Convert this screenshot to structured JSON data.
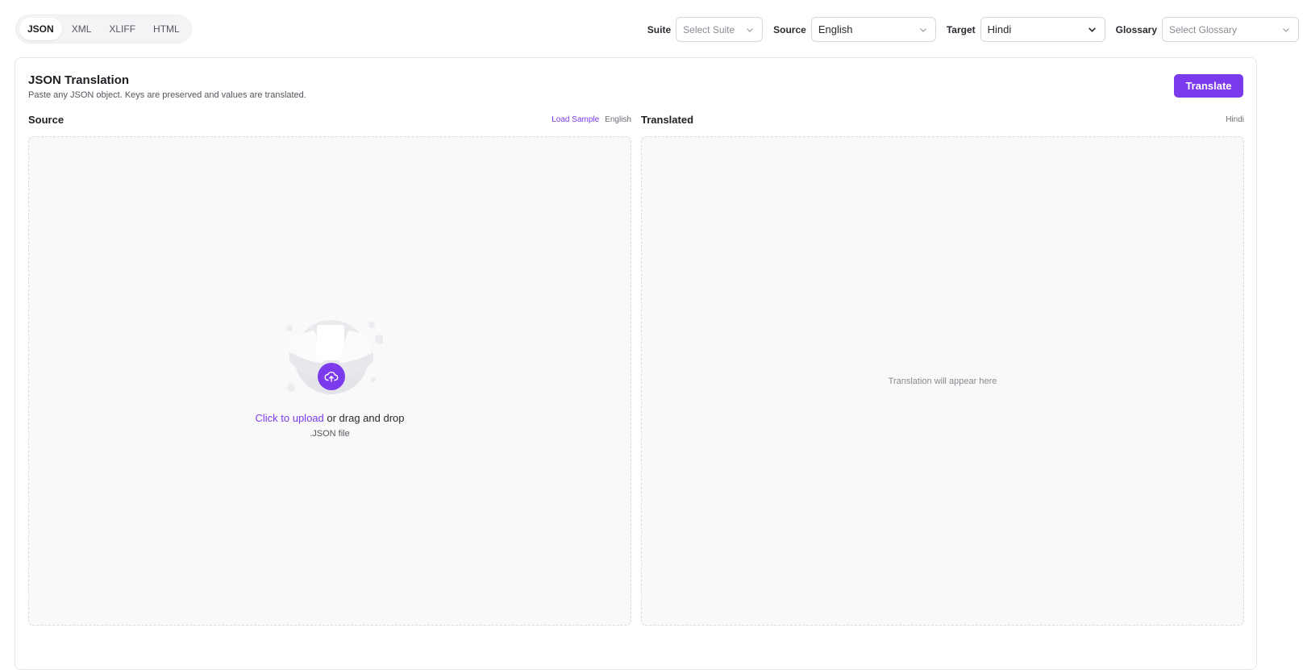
{
  "formats": {
    "tabs": [
      {
        "label": "JSON",
        "active": true
      },
      {
        "label": "XML",
        "active": false
      },
      {
        "label": "XLIFF",
        "active": false
      },
      {
        "label": "HTML",
        "active": false
      }
    ]
  },
  "selectors": {
    "suite": {
      "label": "Suite",
      "placeholder": "Select Suite"
    },
    "source": {
      "label": "Source",
      "value": "English"
    },
    "target": {
      "label": "Target",
      "value": "Hindi"
    },
    "glossary": {
      "label": "Glossary",
      "placeholder": "Select Glossary"
    }
  },
  "card": {
    "title": "JSON Translation",
    "subtitle": "Paste any JSON object. Keys are preserved and values are translated.",
    "translate_label": "Translate"
  },
  "source_pane": {
    "heading": "Source",
    "load_sample": "Load Sample",
    "language": "English",
    "upload_link": "Click to upload",
    "upload_rest": " or drag and drop",
    "file_hint": ".JSON file"
  },
  "translated_pane": {
    "heading": "Translated",
    "language": "Hindi",
    "placeholder": "Translation will appear here"
  },
  "colors": {
    "accent": "#7c3aed",
    "border": "#e6e6ea",
    "pane_bg": "#f9f9fa"
  },
  "icons": {
    "upload": "cloud-upload-icon",
    "dropdown": "chevron-down-icon"
  }
}
